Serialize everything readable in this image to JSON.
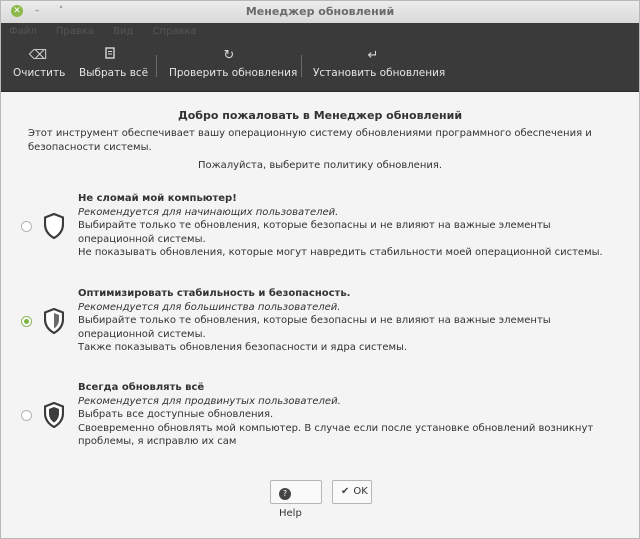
{
  "window": {
    "title": "Менеджер обновлений"
  },
  "menu": {
    "items": [
      "Файл",
      "Правка",
      "Вид",
      "Справка"
    ]
  },
  "toolbar": {
    "clear": {
      "label": "Очистить",
      "icon": "backspace-icon"
    },
    "select_all": {
      "label": "Выбрать всё",
      "icon": "document-icon"
    },
    "refresh": {
      "label": "Проверить обновления",
      "icon": "refresh-icon"
    },
    "install": {
      "label": "Установить обновления",
      "icon": "enter-icon"
    }
  },
  "content": {
    "welcome": "Добро пожаловать в Менеджер обновлений",
    "intro": "Этот инструмент обеспечивает вашу операционную систему обновлениями программного обеспечения и безопасности системы.",
    "choose": "Пожалуйста, выберите политику обновления."
  },
  "options": [
    {
      "title": "Не сломай мой компьютер!",
      "recommended": "Рекомендуется для начинающих пользователей.",
      "line1": "Выбирайте только те обновления, которые безопасны и не влияют на важные элементы операционной системы.",
      "line2": "Не показывать обновления, которые могут навредить стабильности моей операционной системы.",
      "selected": false,
      "shield_level": 1
    },
    {
      "title": "Оптимизировать стабильность и безопасность.",
      "recommended": "Рекомендуется для большинства пользователей.",
      "line1": "Выбирайте только те обновления, которые безопасны и не влияют на важные элементы операционной системы.",
      "line2": "Также показывать обновления безопасности и ядра системы.",
      "selected": true,
      "shield_level": 2
    },
    {
      "title": "Всегда обновлять всё",
      "recommended": "Рекомендуется для продвинутых пользователей.",
      "line1": "Выбрать все доступные обновления.",
      "line2": "Своевременно обновлять мой компьютер. В случае если после установке обновлений возникнут проблемы, я исправлю их сам",
      "selected": false,
      "shield_level": 3
    }
  ],
  "buttons": {
    "help": "Help",
    "ok": "OK"
  },
  "colors": {
    "toolbar_bg": "#3a3a3a",
    "accent": "#7db341",
    "text": "#333333"
  }
}
